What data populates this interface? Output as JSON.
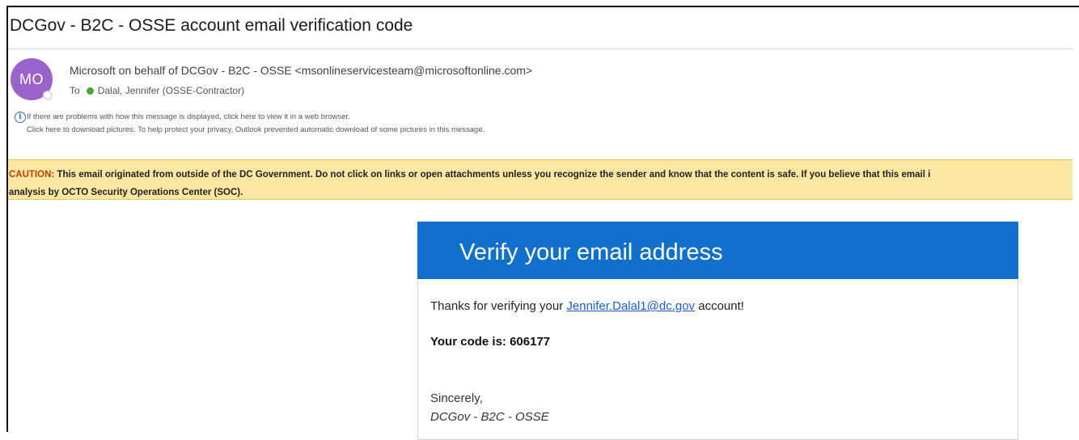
{
  "message": {
    "subject": "DCGov - B2C - OSSE account email verification code",
    "avatar_initials": "MO",
    "sender": "Microsoft on behalf of DCGov - B2C - OSSE <msonlineservicesteam@microsoftonline.com>",
    "to_label": "To",
    "recipient": "Dalal, Jennifer (OSSE-Contractor)",
    "info_line_1": "If there are problems with how this message is displayed, click here to view it in a web browser.",
    "info_line_2": "Click here to download pictures. To help protect your privacy, Outlook prevented automatic download of some pictures in this message."
  },
  "caution": {
    "lead": "CAUTION:",
    "line1_rest": " This email originated from outside of the DC Government. Do not click on links or open attachments unless you recognize the sender and know that the content is safe. If you believe that this email i",
    "line2": "analysis by OCTO Security Operations Center (SOC)."
  },
  "body": {
    "banner_title": "Verify your email address",
    "thanks_prefix": "Thanks for verifying your ",
    "email_link": "Jennifer.Dalal1@dc.gov",
    "thanks_suffix": " account!",
    "code_text": "Your code is: 606177",
    "sincerely": "Sincerely,",
    "signature": "DCGov - B2C - OSSE"
  },
  "colors": {
    "avatar": "#9a63c9",
    "banner": "#1070cc",
    "caution_bg": "#fbe7a2",
    "caution_lead": "#c04000",
    "link": "#1a5fd0",
    "presence": "#4aa534"
  },
  "icons": {
    "info": "info-icon",
    "status": "online-status-icon"
  }
}
